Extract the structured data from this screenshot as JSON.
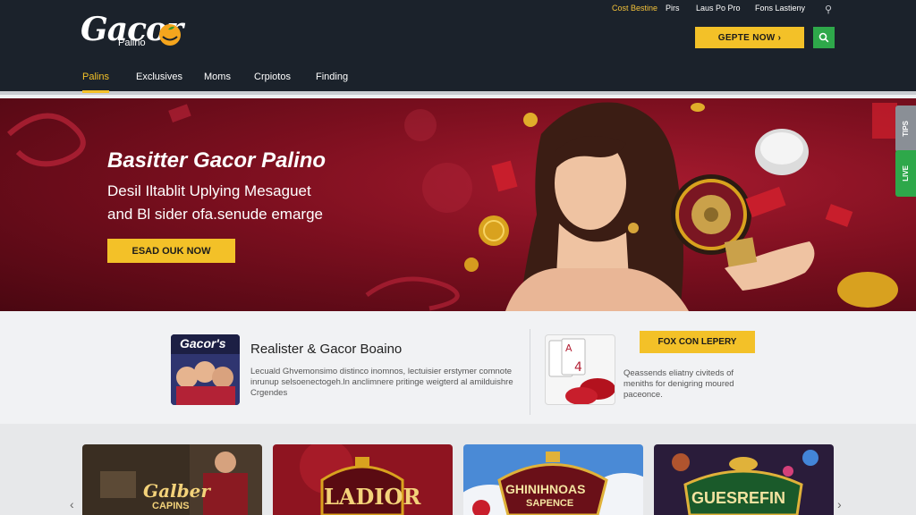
{
  "brand": {
    "logo_text": "Gacor",
    "logo_sub": "Palino"
  },
  "top_links": [
    "Cost Bestine",
    "Pirs",
    "Laus Po Pro",
    "Fons Lastieny"
  ],
  "header": {
    "cta_label": "GEPTE NOW ›",
    "nav": [
      "Palins",
      "Exclusives",
      "Moms",
      "Crpiotos",
      "Finding"
    ],
    "active_nav": "Palins"
  },
  "hero": {
    "title": "Basitter Gacor Palino",
    "line1": "Desil Iltablit Uplying Mesaguet",
    "line2": "and Bl sider ofa.senude emarge",
    "button": "ESAD OUK NOW",
    "side_tab_1": "TIPS",
    "side_tab_2": "LIVE"
  },
  "promo": {
    "thumb_label": "Gacor's",
    "title": "Realister & Gacor Boaino",
    "description": "Lecuald Ghvemonsimo distinco inomnos, lectuisier erstymer comnote inrunup selsoenectogeh.ln anclimnere pritinge weigterd al amilduishre Crgendes",
    "button": "FOX CON LEPERY",
    "description2": "Qeassends eliatny civiteds of meniths for denigring moured paceonce."
  },
  "games": [
    {
      "title": "Galber",
      "subtitle": "CAPINS"
    },
    {
      "title": "LADIOR",
      "subtitle": ""
    },
    {
      "title": "GHINIHNOAS",
      "subtitle": "SAPENCE"
    },
    {
      "title": "GUESREFIN",
      "subtitle": ""
    }
  ],
  "colors": {
    "accent": "#f3c128",
    "header_bg": "#1b222b",
    "hero_bg": "#7c0f1f",
    "search_bg": "#2ea84a"
  }
}
